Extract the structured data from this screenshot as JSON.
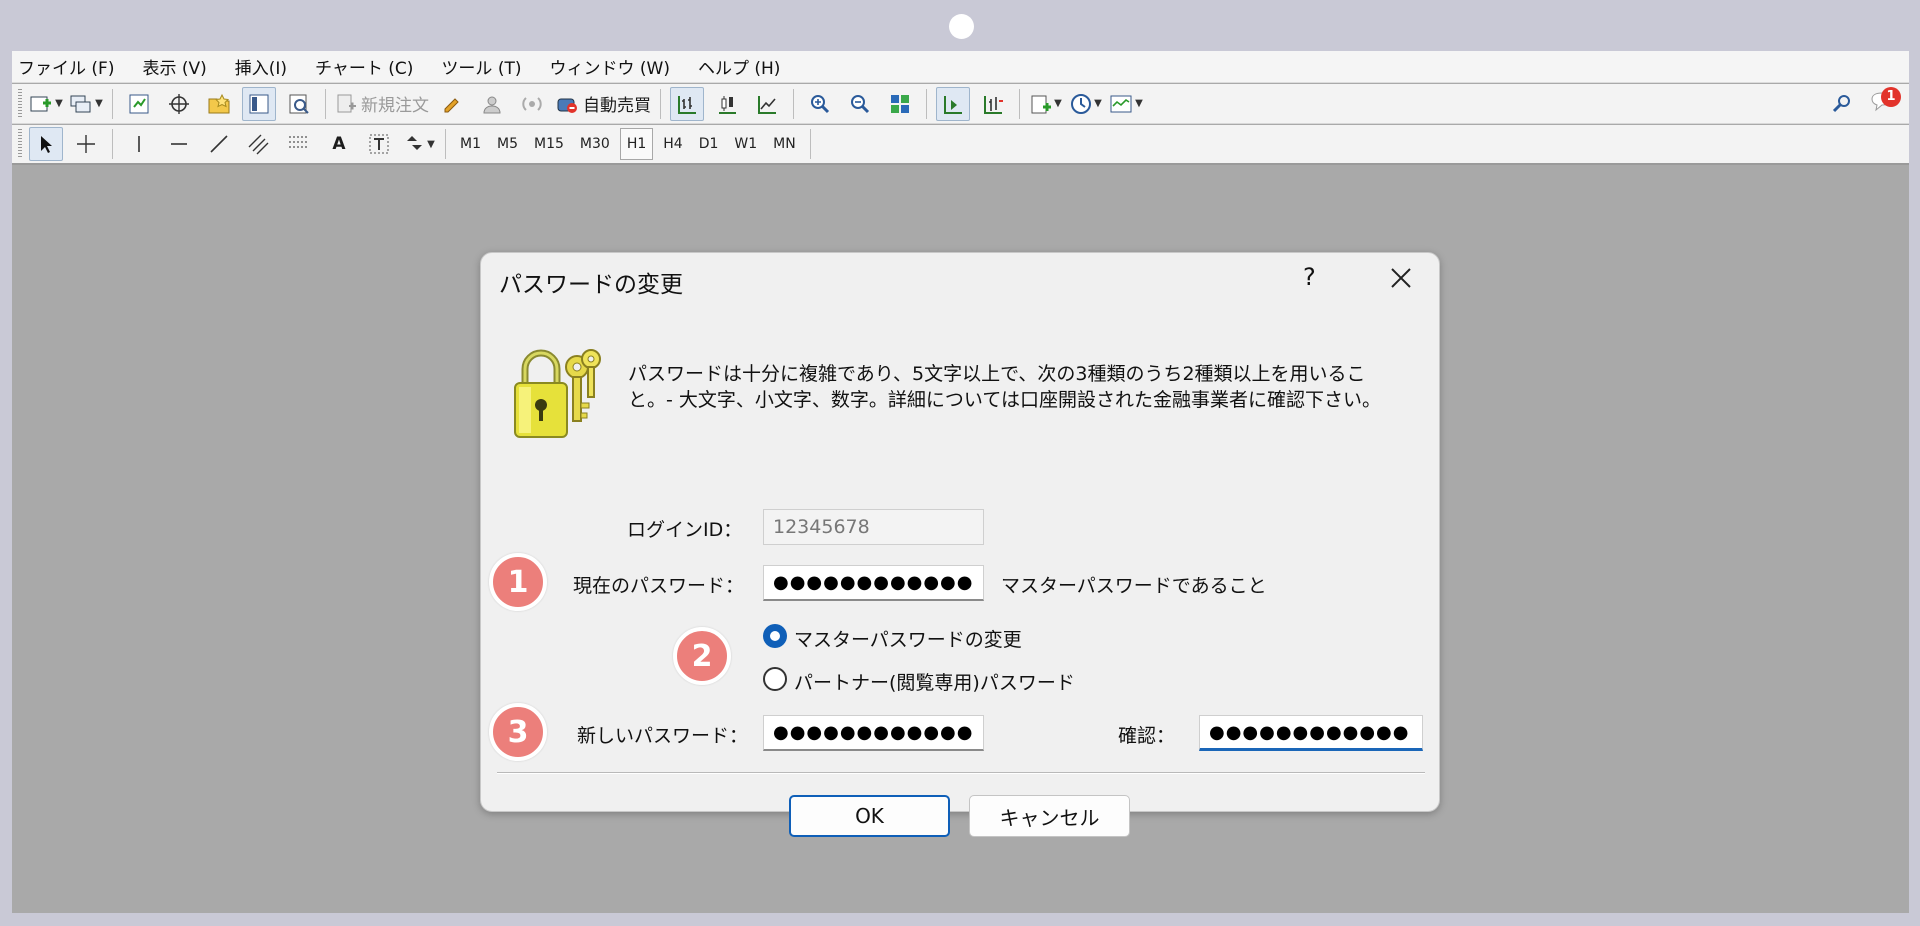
{
  "menu": [
    "ファイル (F)",
    "表示 (V)",
    "挿入(I)",
    "チャート (C)",
    "ツール (T)",
    "ウィンドウ (W)",
    "ヘルプ (H)"
  ],
  "toolbar": {
    "new_order_label": "新規注文",
    "auto_trade_label": "自動売買",
    "notification_count": "1"
  },
  "timeframes": [
    "M1",
    "M5",
    "M15",
    "M30",
    "H1",
    "H4",
    "D1",
    "W1",
    "MN"
  ],
  "active_timeframe": "H1",
  "dialog": {
    "title": "パスワードの変更",
    "help_label": "?",
    "info_text": "パスワードは十分に複雑であり、5文字以上で、次の3種類のうち2種類以上を用いること。- 大文字、小文字、数字。詳細については口座開設された金融事業者に確認下さい。",
    "login_label": "ログインID：",
    "login_value": "12345678",
    "current_password_label": "現在のパスワード：",
    "current_password_value": "●●●●●●●●●●●●",
    "master_note": "マスターパスワードであること",
    "radio_master_label": "マスターパスワードの変更",
    "radio_partner_label": "パートナー(閲覧専用)パスワード",
    "new_password_label": "新しいパスワード：",
    "new_password_value": "●●●●●●●●●●●●",
    "confirm_label": "確認：",
    "confirm_value": "●●●●●●●●●●●●",
    "ok_label": "OK",
    "cancel_label": "キャンセル"
  },
  "steps": [
    "1",
    "2",
    "3"
  ],
  "colors": {
    "accent": "#0f5fb8",
    "step_badge": "#ec7f7b",
    "frame": "#c9c9d6",
    "workspace": "#a9a9a9"
  }
}
